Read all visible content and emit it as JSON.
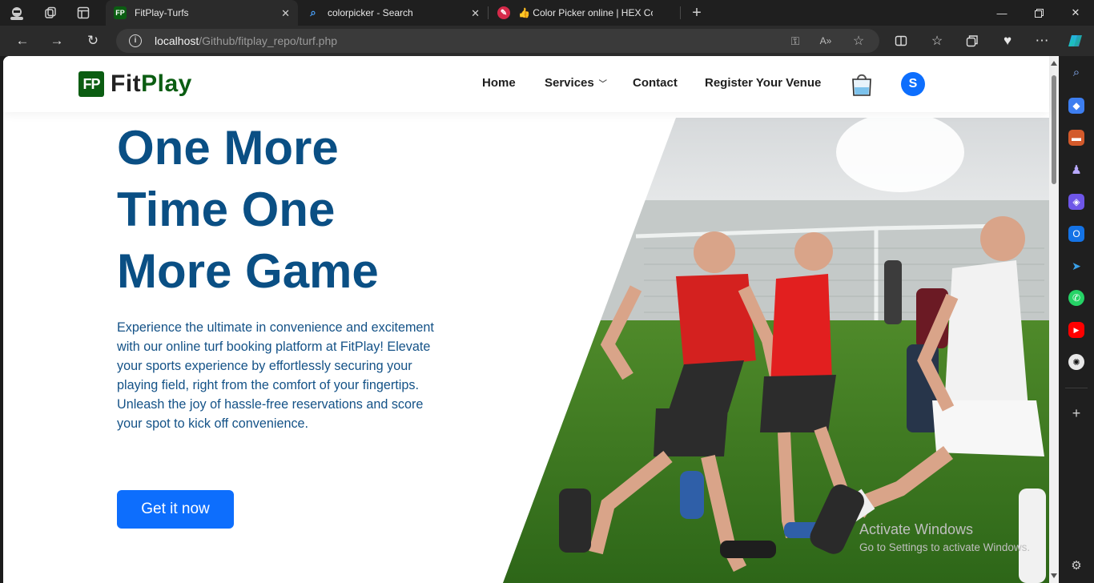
{
  "tabs": [
    {
      "title": "FitPlay-Turfs",
      "favicon": "FP",
      "active": true
    },
    {
      "title": "colorpicker - Search",
      "favicon": "search-icon",
      "active": false
    },
    {
      "title": "👍 Color Picker online | HEX Colo",
      "favicon": "color-picker-icon",
      "active": false
    }
  ],
  "address_bar": {
    "host": "localhost",
    "path": "/Github/fitplay_repo/turf.php"
  },
  "site": {
    "logo_mark": "FP",
    "logo_word_1": "Fit",
    "logo_word_2": "Play",
    "menu": {
      "home": "Home",
      "services": "Services",
      "contact": "Contact",
      "register": "Register Your Venue"
    },
    "avatar_initial": "S"
  },
  "hero": {
    "title_line_1": "One More",
    "title_line_2": "Time One",
    "title_line_3": "More Game",
    "description": "Experience the ultimate in convenience and excitement with our online turf booking platform at FitPlay! Elevate your sports experience by effortlessly securing your playing field, right from the comfort of your fingertips. Unleash the joy of hassle-free reservations and score your spot to kick off convenience.",
    "cta": "Get it now"
  },
  "watermark": {
    "line_1": "Activate Windows",
    "line_2": "Go to Settings to activate Windows."
  },
  "colors": {
    "brand_green": "#0b5d12",
    "title_blue": "#0a4f84",
    "cta_blue": "#0d6efd"
  }
}
